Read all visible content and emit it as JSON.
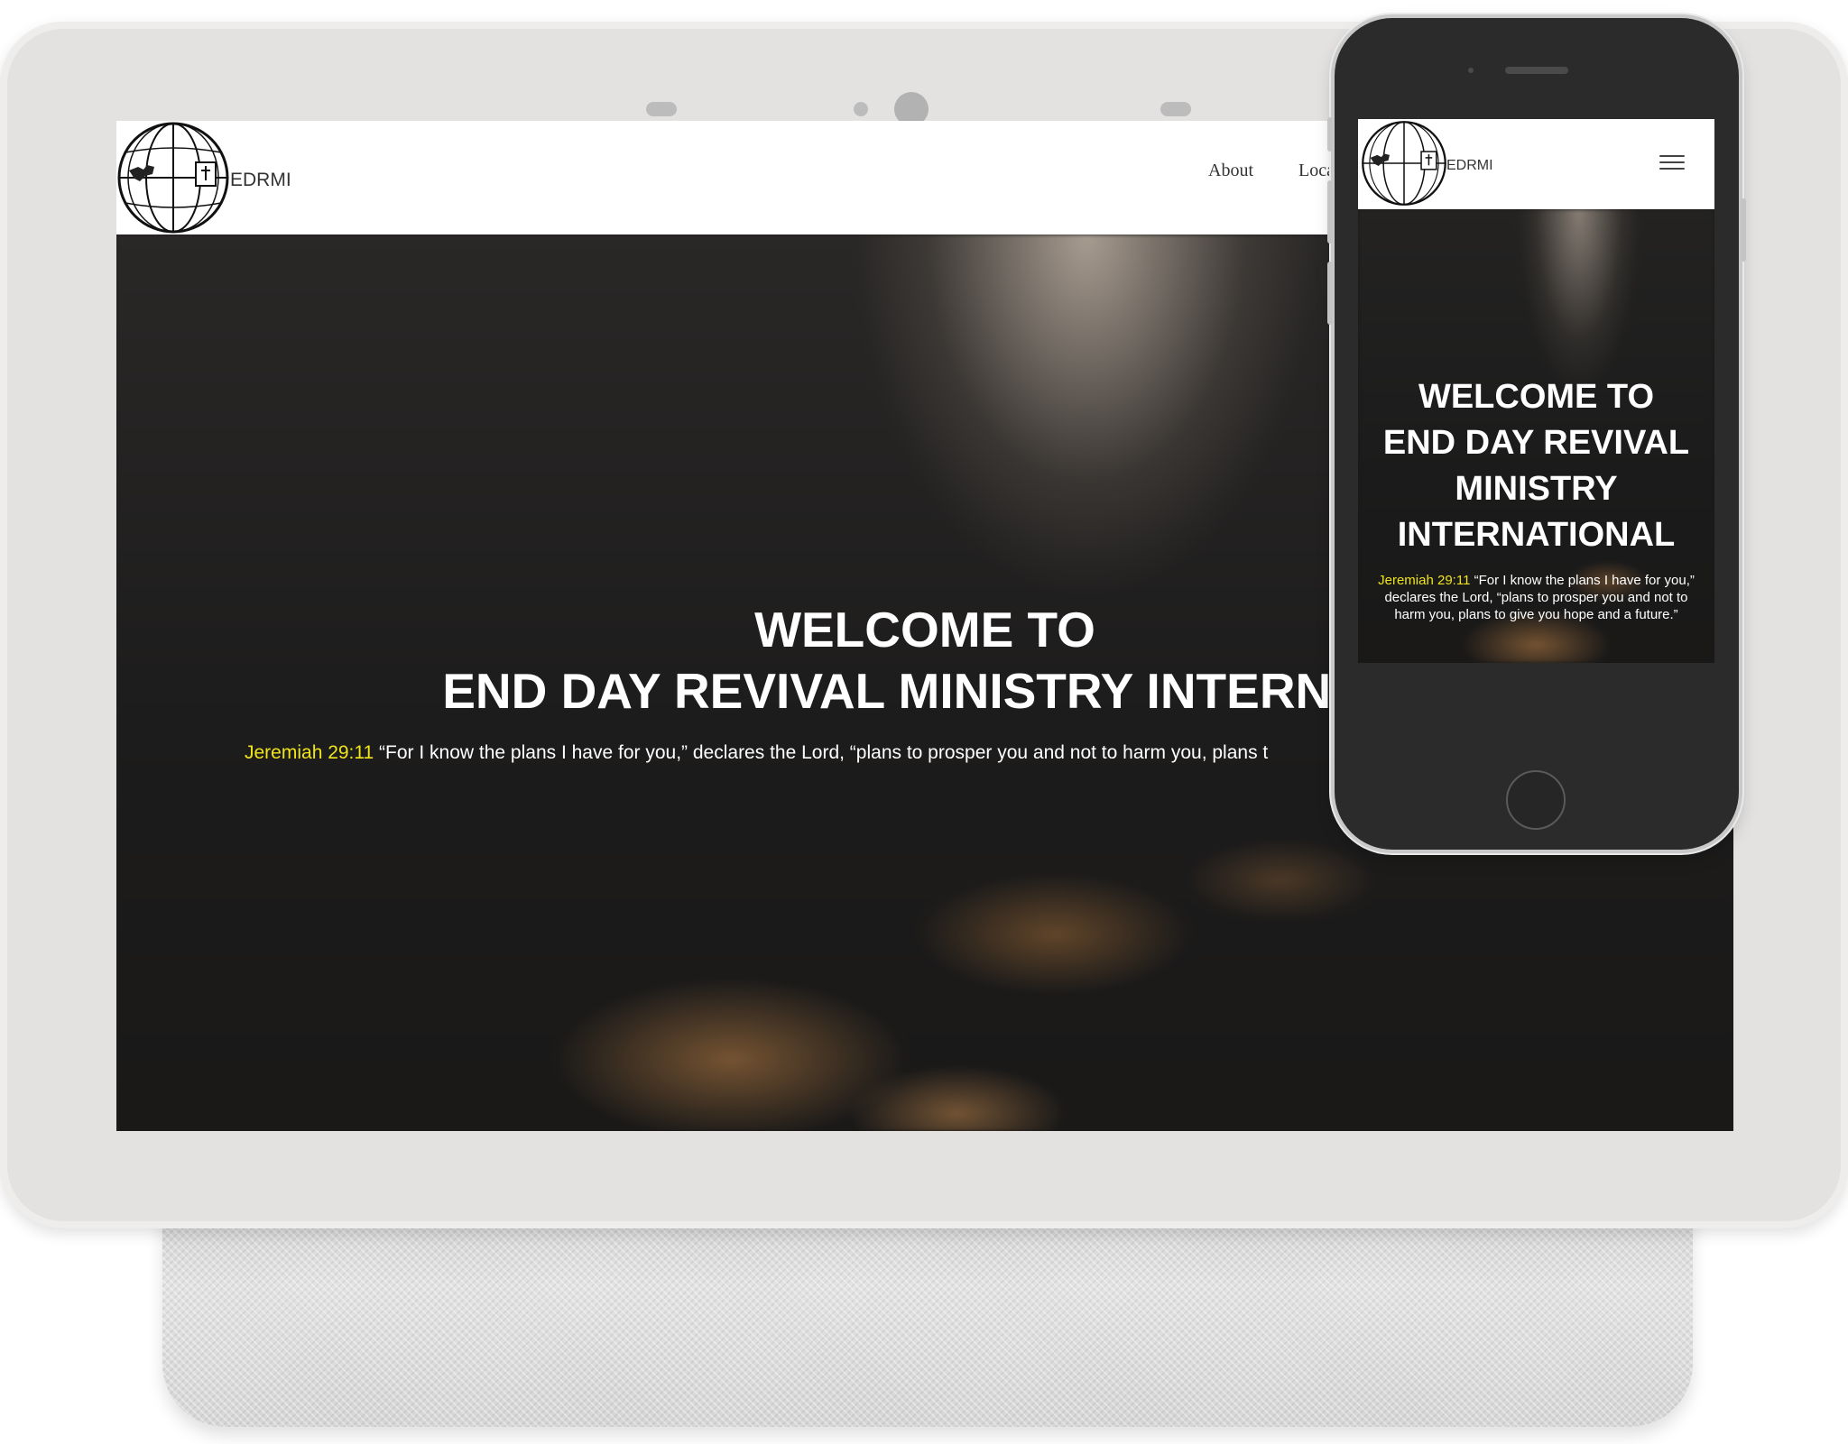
{
  "tablet": {
    "brand": "EDRMI",
    "nav": {
      "about": "About",
      "location_partial": "Loca"
    },
    "hero": {
      "line1": "WELCOME TO",
      "line2": "END DAY REVIVAL MINISTRY INTERNATI",
      "verse_ref": "Jeremiah 29:11",
      "verse_text": " “For I know the plans I have for you,” declares the Lord, “plans to prosper you and not to harm you, plans t"
    }
  },
  "phone": {
    "brand": "EDRMI",
    "hero": {
      "line1": "WELCOME TO",
      "line2": "END DAY REVIVAL",
      "line3": "MINISTRY",
      "line4": "INTERNATIONAL",
      "verse_ref": "Jeremiah 29:11",
      "verse_text_1": " “For I know the plans I have for you,”",
      "verse_text_2": "declares the Lord, “plans to prosper you and not to",
      "verse_text_3": "harm you, plans to give you hope and a future.”"
    }
  },
  "colors": {
    "verse_ref": "#f0e41a",
    "hero_text": "#ffffff",
    "navbar_bg": "#ffffff",
    "device_frame": "#e3e2e1"
  },
  "icons": [
    "globe-logo-icon",
    "hamburger-menu-icon"
  ]
}
